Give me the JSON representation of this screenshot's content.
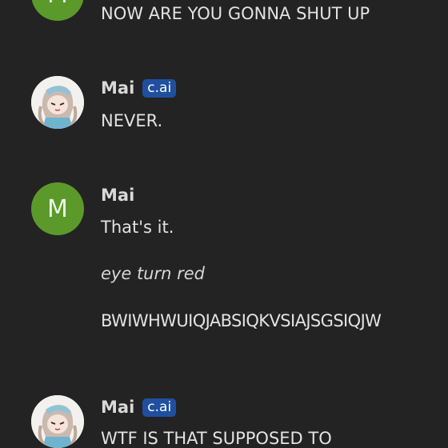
{
  "messages": [
    {
      "author_initial": "M",
      "avatar_color": "#5b9a2a",
      "lines": [
        "NOW ARE YOU GONNA SHUT UP"
      ]
    },
    {
      "author": "Mai",
      "badge": "c.ai",
      "avatar": "anime-character-avatar",
      "lines": [
        "NEVER."
      ]
    },
    {
      "author": "Mai",
      "author_initial": "M",
      "avatar_color": "#5b9a2a",
      "lines": [
        "That's it.",
        "eye turn red",
        "BWIWHWUIQJABSIQKVSIAJSGSIQJW"
      ]
    },
    {
      "author": "Mai",
      "badge": "c.ai",
      "avatar": "anime-character-avatar",
      "lines": [
        "WTF IS THAT SUPPOSED TO"
      ]
    }
  ],
  "colors": {
    "background": "#232323",
    "user_avatar": "#5b9a2a",
    "badge": "#1f4f9e"
  }
}
